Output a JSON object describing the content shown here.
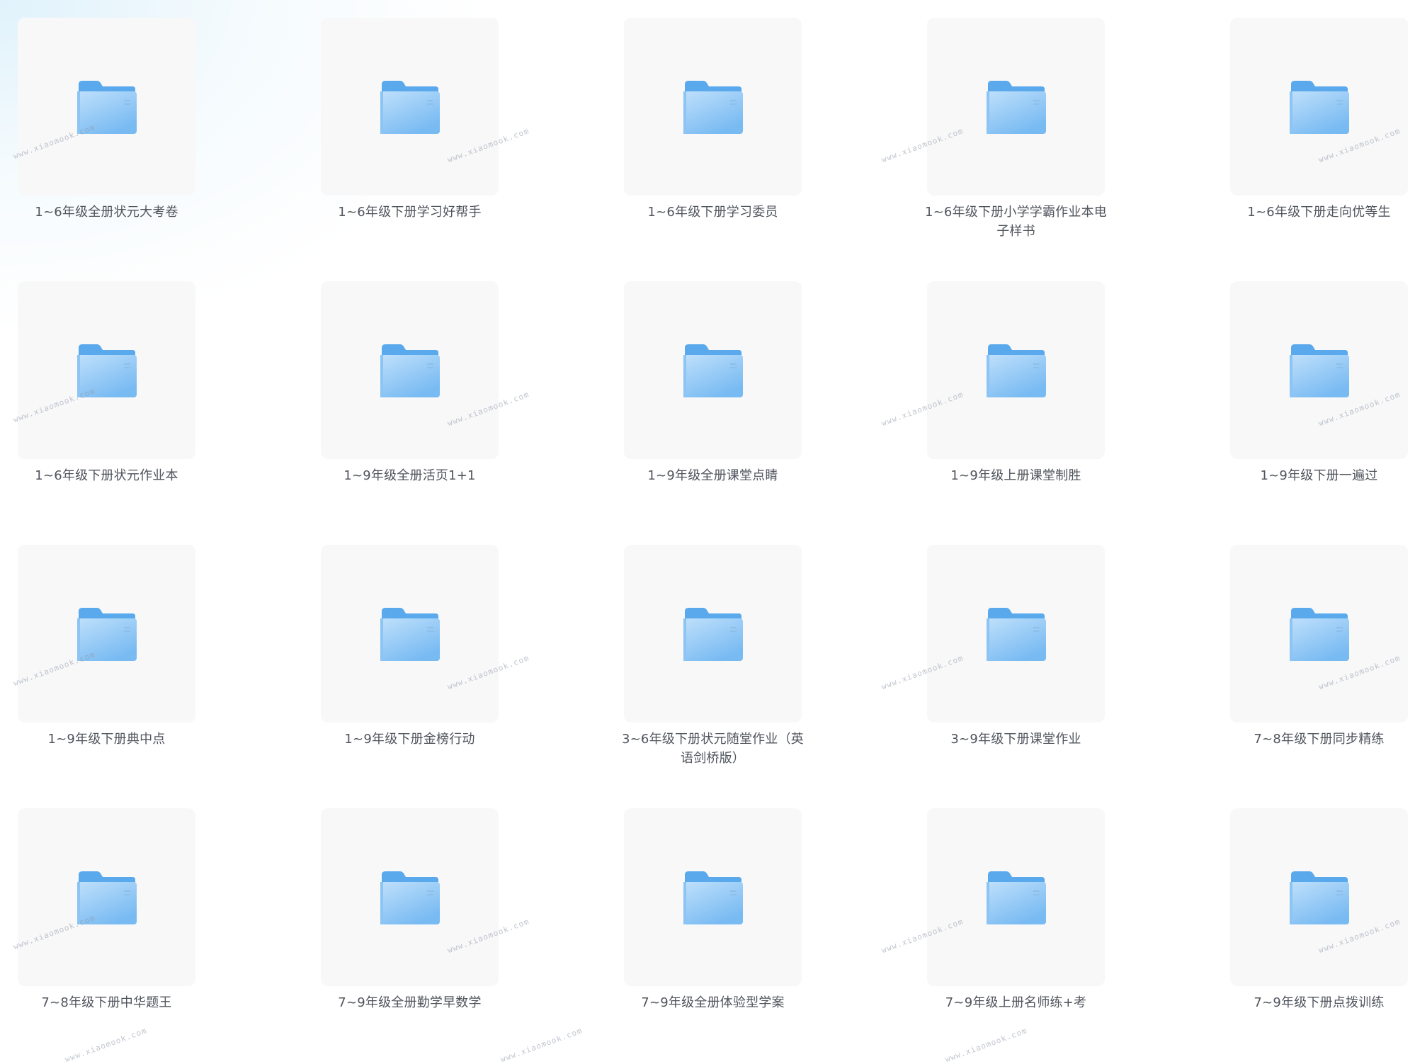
{
  "watermark_text": "www.xiaomook.com",
  "icons": {
    "folder": "folder-icon"
  },
  "colors": {
    "tile_bg": "#f8f8f9",
    "folder_back": "#5aa9ec",
    "folder_front_top": "#b9dcfb",
    "folder_front_bottom": "#7cbdf3",
    "label": "#50545c"
  },
  "folders": [
    {
      "name": "1~6年级全册状元大考卷"
    },
    {
      "name": "1~6年级下册学习好帮手"
    },
    {
      "name": "1~6年级下册学习委员"
    },
    {
      "name": "1~6年级下册小学学霸作业本电子样书"
    },
    {
      "name": "1~6年级下册走向优等生"
    },
    {
      "name": "1~6年级下册状元作业本"
    },
    {
      "name": "1~9年级全册活页1+1"
    },
    {
      "name": "1~9年级全册课堂点睛"
    },
    {
      "name": "1~9年级上册课堂制胜"
    },
    {
      "name": "1~9年级下册一遍过"
    },
    {
      "name": "1~9年级下册典中点"
    },
    {
      "name": "1~9年级下册金榜行动"
    },
    {
      "name": "3~6年级下册状元随堂作业（英语剑桥版）"
    },
    {
      "name": "3~9年级下册课堂作业"
    },
    {
      "name": "7~8年级下册同步精练"
    },
    {
      "name": "7~8年级下册中华题王"
    },
    {
      "name": "7~9年级全册勤学早数学"
    },
    {
      "name": "7~9年级全册体验型学案"
    },
    {
      "name": "7~9年级上册名师练+考"
    },
    {
      "name": "7~9年级下册点拨训练"
    }
  ]
}
